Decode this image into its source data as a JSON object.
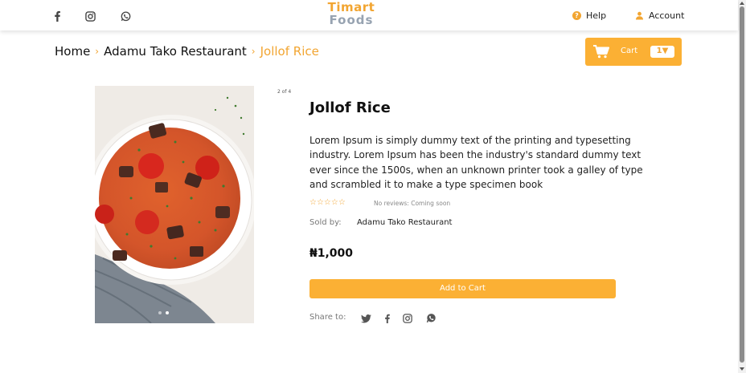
{
  "header": {
    "social_icons": [
      "facebook-icon",
      "instagram-icon",
      "whatsapp-icon"
    ],
    "logo": {
      "line1": "Timart",
      "line2": "Foods"
    },
    "help_label": "Help",
    "account_label": "Account"
  },
  "breadcrumb": {
    "items": [
      "Home",
      "Adamu Tako Restaurant"
    ],
    "current": "Jollof Rice",
    "separator": "›"
  },
  "cart": {
    "label": "Cart",
    "count": "1▼"
  },
  "gallery": {
    "counter": "2 of 4",
    "total_images": 4,
    "active_index": 1
  },
  "product": {
    "name": "Jollof Rice",
    "description": "Lorem Ipsum is simply dummy text of the printing and typesetting industry. Lorem Ipsum has been the industry's standard dummy text ever since the 1500s, when an unknown printer took a galley of type and scrambled it to make a type specimen book",
    "rating": 0,
    "stars": "☆☆☆☆☆",
    "reviews_text": "No reviews: Coming soon",
    "sold_by_label": "Sold by:",
    "sold_by_value": "Adamu Tako Restaurant",
    "price": "₦1,000",
    "add_to_cart_label": "Add to Cart",
    "share_label": "Share to:",
    "share_icons": [
      "twitter-icon",
      "facebook-icon",
      "instagram-icon",
      "whatsapp-icon"
    ]
  },
  "colors": {
    "accent": "#fbb034",
    "accent_text": "#f2a531",
    "logo_grey": "#97a3b1"
  }
}
